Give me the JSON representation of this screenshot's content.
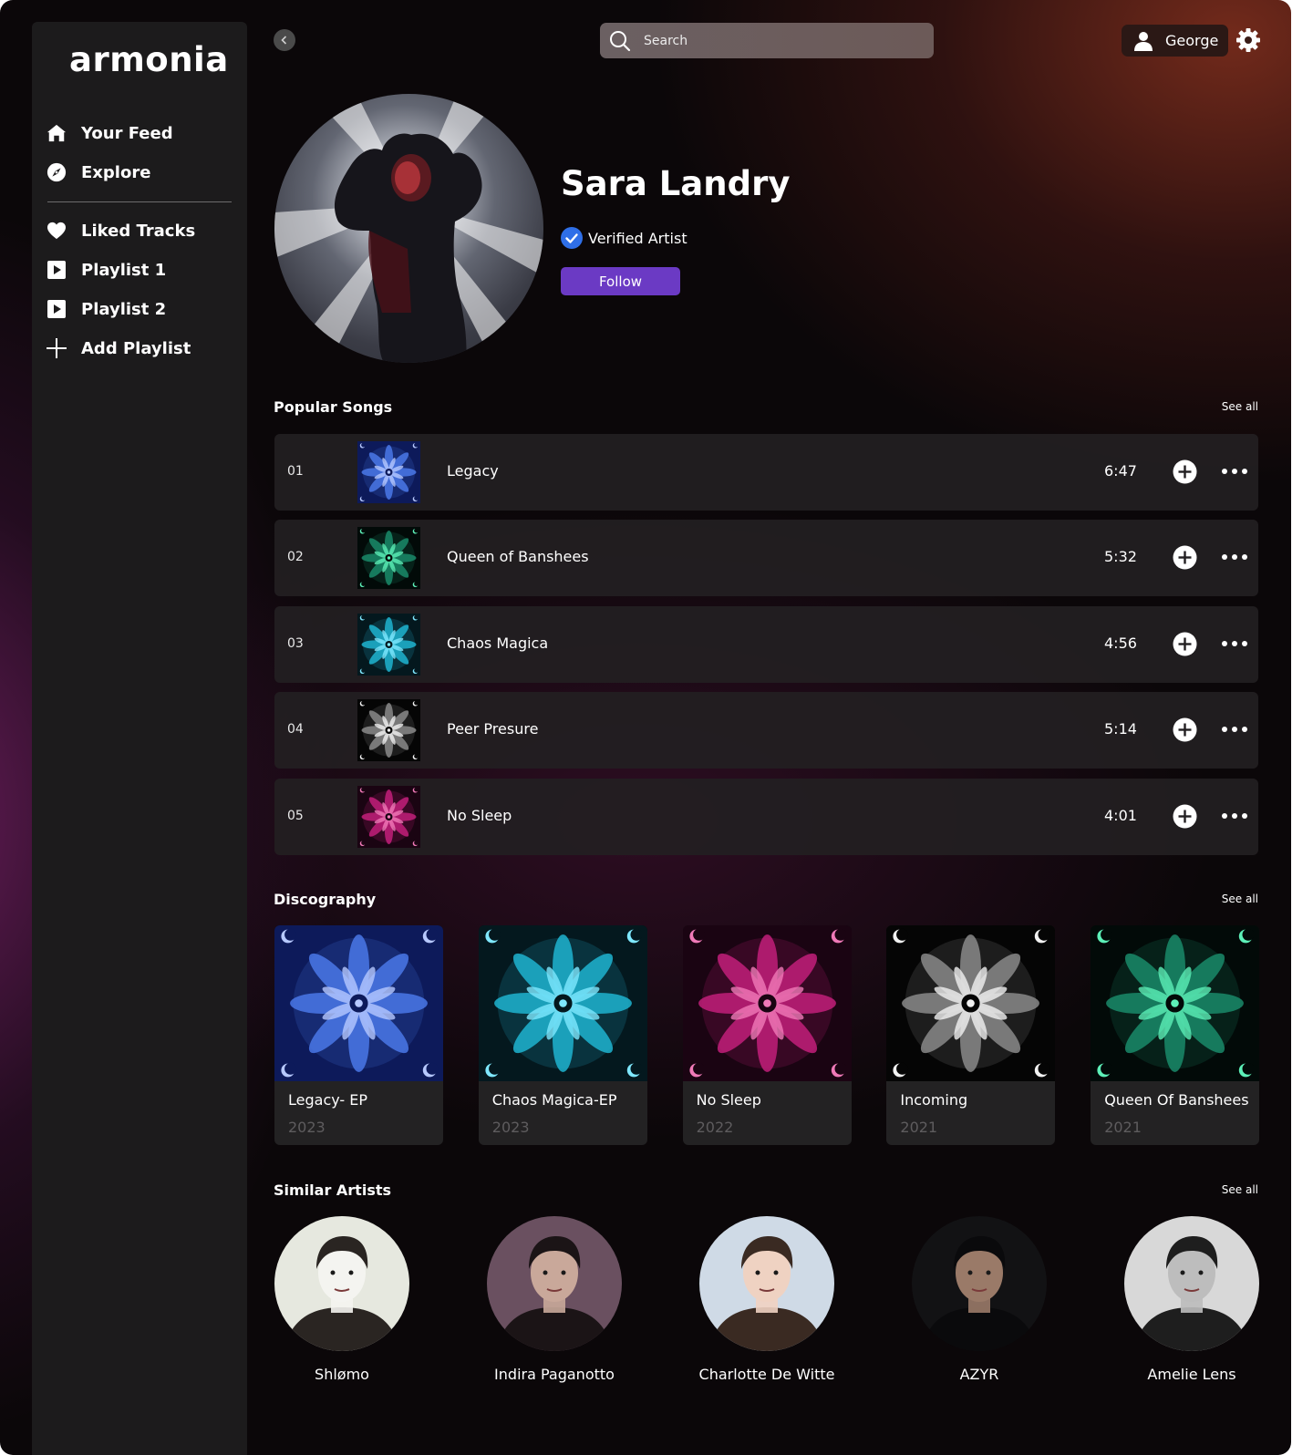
{
  "app": {
    "logo": "armonia"
  },
  "sidebar": {
    "items": [
      {
        "label": "Your Feed",
        "icon": "home-icon"
      },
      {
        "label": "Explore",
        "icon": "compass-icon"
      },
      {
        "label": "Liked Tracks",
        "icon": "heart-icon"
      },
      {
        "label": "Playlist 1",
        "icon": "play-square-icon"
      },
      {
        "label": "Playlist 2",
        "icon": "play-square-icon"
      },
      {
        "label": "Add Playlist",
        "icon": "plus-icon"
      }
    ]
  },
  "header": {
    "search_placeholder": "Search",
    "user_name": "George"
  },
  "artist": {
    "name": "Sara Landry",
    "verified_label": "Verified Artist",
    "follow_label": "Follow"
  },
  "popular": {
    "title": "Popular Songs",
    "see_all": "See all",
    "songs": [
      {
        "num": "01",
        "title": "Legacy",
        "duration": "6:47"
      },
      {
        "num": "02",
        "title": "Queen of Banshees",
        "duration": "5:32"
      },
      {
        "num": "03",
        "title": "Chaos Magica",
        "duration": "4:56"
      },
      {
        "num": "04",
        "title": "Peer Presure",
        "duration": "5:14"
      },
      {
        "num": "05",
        "title": "No Sleep",
        "duration": "4:01"
      }
    ]
  },
  "discography": {
    "title": "Discography",
    "see_all": "See all",
    "albums": [
      {
        "title": "Legacy- EP",
        "year": "2023"
      },
      {
        "title": "Chaos Magica-EP",
        "year": "2023"
      },
      {
        "title": "No Sleep",
        "year": "2022"
      },
      {
        "title": "Incoming",
        "year": "2021"
      },
      {
        "title": "Queen Of Banshees",
        "year": "2021"
      }
    ]
  },
  "similar": {
    "title": "Similar Artists",
    "see_all": "See all",
    "artists": [
      {
        "name": "Shlømo"
      },
      {
        "name": "Indira Paganotto"
      },
      {
        "name": "Charlotte De Witte"
      },
      {
        "name": "AZYR"
      },
      {
        "name": "Amelie Lens"
      }
    ]
  },
  "colors": {
    "accent": "#6b3ac4",
    "verified": "#2f6fe8",
    "sidebar_bg": "#1c1b1c",
    "row_bg": "#221f21"
  }
}
